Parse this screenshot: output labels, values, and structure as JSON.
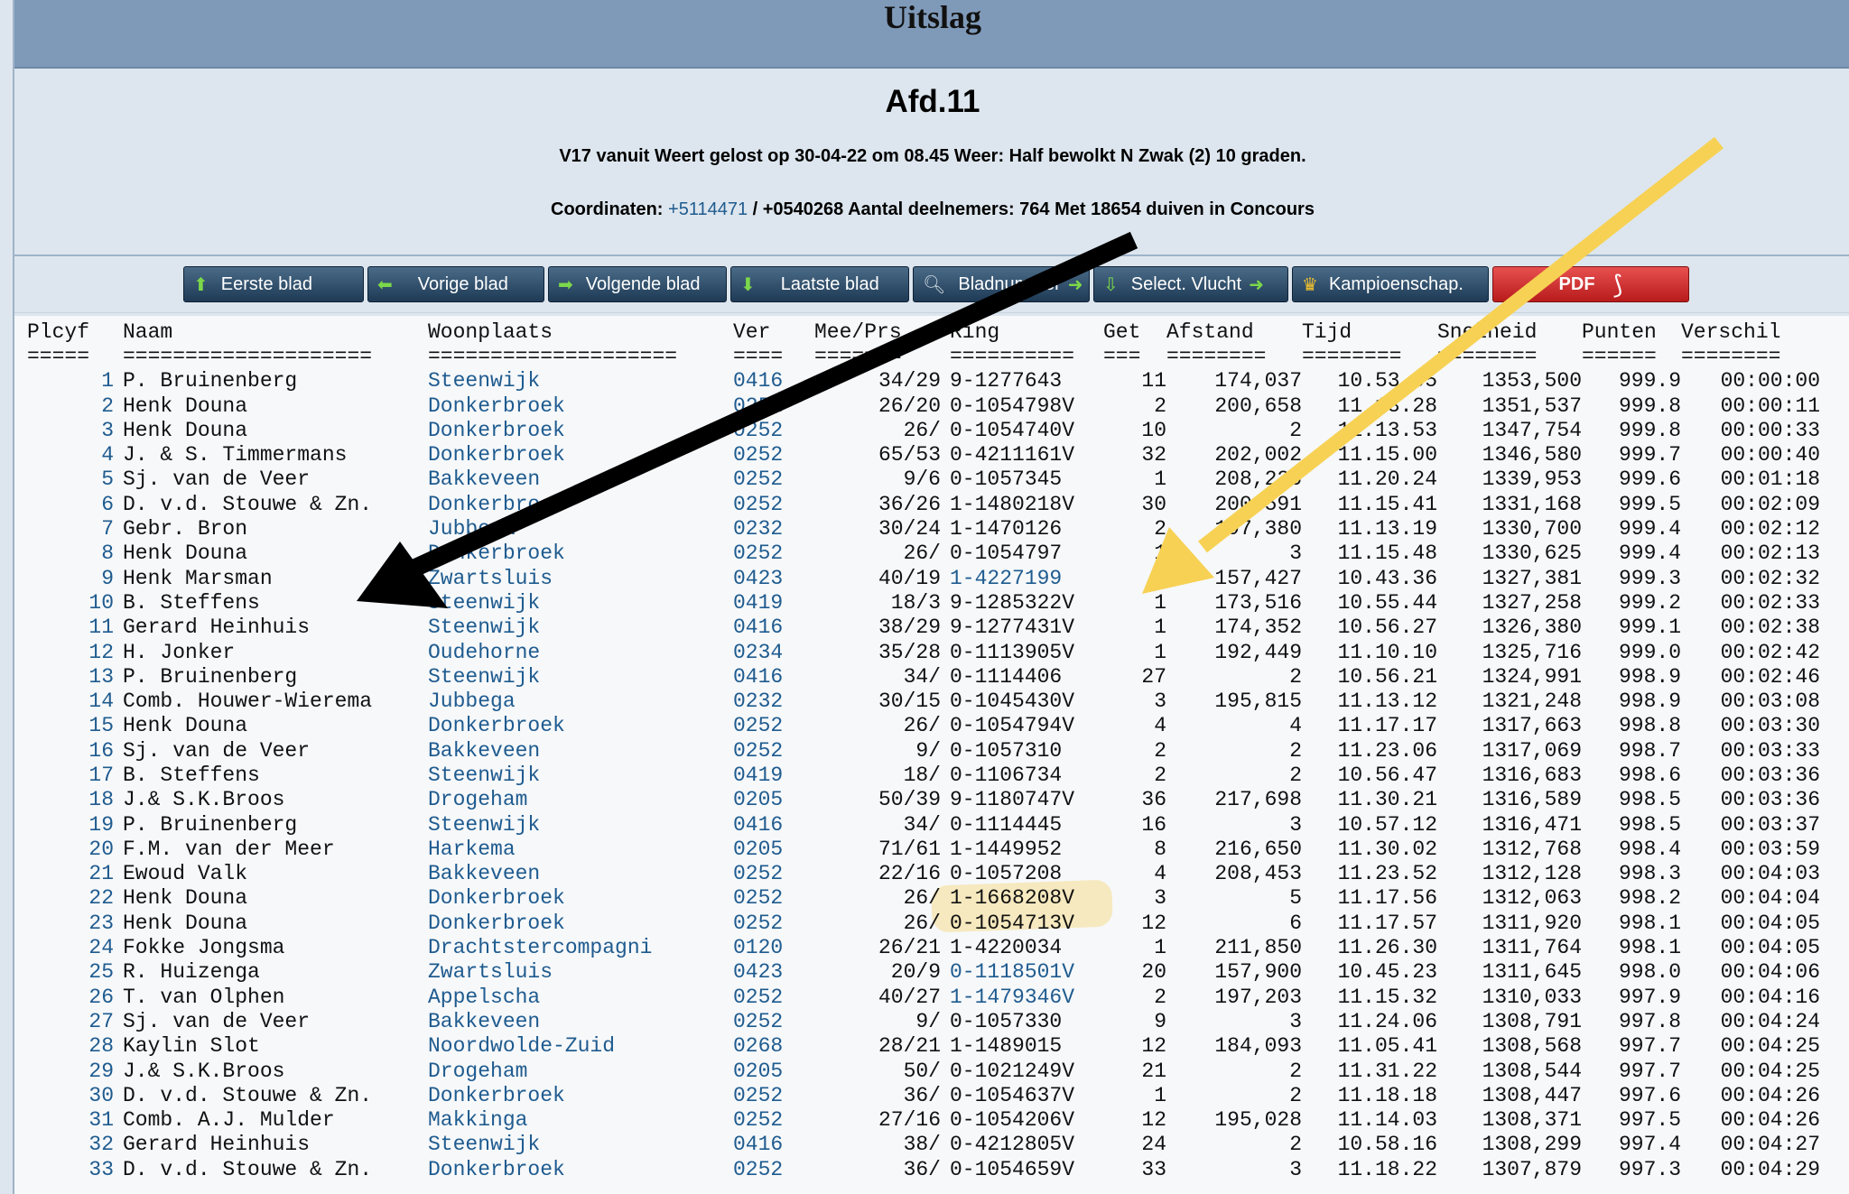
{
  "header": {
    "title": "Uitslag"
  },
  "info": {
    "afdeling": "Afd.11",
    "line1": "V17 vanuit Weert gelost op 30-04-22 om 08.45 Weer: Half bewolkt N Zwak (2) 10 graden.",
    "coord_label": "Coordinaten:",
    "coord_link": "+5114471",
    "coord_rest": "/ +0540268 Aantal deelnemers: 764 Met 18654 duiven in Concours"
  },
  "toolbar": {
    "first": "Eerste blad",
    "prev": "Vorige blad",
    "next": "Volgende blad",
    "last": "Laatste blad",
    "pagenum": "Bladnummer",
    "select": "Select. Vlucht",
    "kamp": "Kampioenschap.",
    "pdf": "PDF"
  },
  "table": {
    "headers": [
      "Plcyf",
      "Naam",
      "Woonplaats",
      "Ver",
      "Mee/Prs",
      "Ring",
      "Get",
      "Afstand",
      "Tijd",
      "Snelheid",
      "Punten",
      "Verschil"
    ],
    "separators": [
      "=====",
      "====================",
      "====================",
      "====",
      "=======",
      "==========",
      "===",
      "========",
      "========",
      "========",
      "======",
      "========"
    ],
    "rows": [
      [
        "1",
        "P. Bruinenberg",
        "Steenwijk",
        "0416",
        "34/29",
        "9-1277643",
        "11",
        "174,037",
        "10.53.05",
        "1353,500",
        "999.9",
        "00:00:00"
      ],
      [
        "2",
        "Henk Douna",
        "Donkerbroek",
        "0252",
        "26/20",
        "0-1054798V",
        "2",
        "200,658",
        "11.13.28",
        "1351,537",
        "999.8",
        "00:00:11"
      ],
      [
        "3",
        "Henk Douna",
        "Donkerbroek",
        "0252",
        "26/",
        "0-1054740V",
        "10",
        "2",
        "11.13.53",
        "1347,754",
        "999.8",
        "00:00:33"
      ],
      [
        "4",
        "J. & S. Timmermans",
        "Donkerbroek",
        "0252",
        "65/53",
        "0-4211161V",
        "32",
        "202,002",
        "11.15.00",
        "1346,580",
        "999.7",
        "00:00:40"
      ],
      [
        "5",
        "Sj. van de Veer",
        "Bakkeveen",
        "0252",
        "9/6",
        "0-1057345",
        "1",
        "208,226",
        "11.20.24",
        "1339,953",
        "999.6",
        "00:01:18"
      ],
      [
        "6",
        "D. v.d. Stouwe & Zn.",
        "Donkerbroek",
        "0252",
        "36/26",
        "1-1480218V",
        "30",
        "200,591",
        "11.15.41",
        "1331,168",
        "999.5",
        "00:02:09"
      ],
      [
        "7",
        "Gebr. Bron",
        "Jubbega",
        "0232",
        "30/24",
        "1-1470126",
        "2",
        "197,380",
        "11.13.19",
        "1330,700",
        "999.4",
        "00:02:12"
      ],
      [
        "8",
        "Henk Douna",
        "Donkerbroek",
        "0252",
        "26/",
        "0-1054797",
        "1",
        "3",
        "11.15.48",
        "1330,625",
        "999.4",
        "00:02:13"
      ],
      [
        "9",
        "Henk Marsman",
        "Zwartsluis",
        "0423",
        "40/19",
        "1-4227199",
        "1",
        "157,427",
        "10.43.36",
        "1327,381",
        "999.3",
        "00:02:32"
      ],
      [
        "10",
        "B. Steffens",
        "Steenwijk",
        "0419",
        "18/3",
        "9-1285322V",
        "1",
        "173,516",
        "10.55.44",
        "1327,258",
        "999.2",
        "00:02:33"
      ],
      [
        "11",
        "Gerard Heinhuis",
        "Steenwijk",
        "0416",
        "38/29",
        "9-1277431V",
        "1",
        "174,352",
        "10.56.27",
        "1326,380",
        "999.1",
        "00:02:38"
      ],
      [
        "12",
        "H. Jonker",
        "Oudehorne",
        "0234",
        "35/28",
        "0-1113905V",
        "1",
        "192,449",
        "11.10.10",
        "1325,716",
        "999.0",
        "00:02:42"
      ],
      [
        "13",
        "P. Bruinenberg",
        "Steenwijk",
        "0416",
        "34/",
        "0-1114406",
        "27",
        "2",
        "10.56.21",
        "1324,991",
        "998.9",
        "00:02:46"
      ],
      [
        "14",
        "Comb. Houwer-Wierema",
        "Jubbega",
        "0232",
        "30/15",
        "0-1045430V",
        "3",
        "195,815",
        "11.13.12",
        "1321,248",
        "998.9",
        "00:03:08"
      ],
      [
        "15",
        "Henk Douna",
        "Donkerbroek",
        "0252",
        "26/",
        "0-1054794V",
        "4",
        "4",
        "11.17.17",
        "1317,663",
        "998.8",
        "00:03:30"
      ],
      [
        "16",
        "Sj. van de Veer",
        "Bakkeveen",
        "0252",
        "9/",
        "0-1057310",
        "2",
        "2",
        "11.23.06",
        "1317,069",
        "998.7",
        "00:03:33"
      ],
      [
        "17",
        "B. Steffens",
        "Steenwijk",
        "0419",
        "18/",
        "0-1106734",
        "2",
        "2",
        "10.56.47",
        "1316,683",
        "998.6",
        "00:03:36"
      ],
      [
        "18",
        "J.& S.K.Broos",
        "Drogeham",
        "0205",
        "50/39",
        "9-1180747V",
        "36",
        "217,698",
        "11.30.21",
        "1316,589",
        "998.5",
        "00:03:36"
      ],
      [
        "19",
        "P. Bruinenberg",
        "Steenwijk",
        "0416",
        "34/",
        "0-1114445",
        "16",
        "3",
        "10.57.12",
        "1316,471",
        "998.5",
        "00:03:37"
      ],
      [
        "20",
        "F.M. van der Meer",
        "Harkema",
        "0205",
        "71/61",
        "1-1449952",
        "8",
        "216,650",
        "11.30.02",
        "1312,768",
        "998.4",
        "00:03:59"
      ],
      [
        "21",
        "Ewoud Valk",
        "Bakkeveen",
        "0252",
        "22/16",
        "0-1057208",
        "4",
        "208,453",
        "11.23.52",
        "1312,128",
        "998.3",
        "00:04:03"
      ],
      [
        "22",
        "Henk Douna",
        "Donkerbroek",
        "0252",
        "26/",
        "1-1668208V",
        "3",
        "5",
        "11.17.56",
        "1312,063",
        "998.2",
        "00:04:04"
      ],
      [
        "23",
        "Henk Douna",
        "Donkerbroek",
        "0252",
        "26/",
        "0-1054713V",
        "12",
        "6",
        "11.17.57",
        "1311,920",
        "998.1",
        "00:04:05"
      ],
      [
        "24",
        "Fokke Jongsma",
        "Drachtstercompagni",
        "0120",
        "26/21",
        "1-4220034",
        "1",
        "211,850",
        "11.26.30",
        "1311,764",
        "998.1",
        "00:04:05"
      ],
      [
        "25",
        "R. Huizenga",
        "Zwartsluis",
        "0423",
        "20/9",
        "0-1118501V",
        "20",
        "157,900",
        "10.45.23",
        "1311,645",
        "998.0",
        "00:04:06"
      ],
      [
        "26",
        "T. van Olphen",
        "Appelscha",
        "0252",
        "40/27",
        "1-1479346V",
        "2",
        "197,203",
        "11.15.32",
        "1310,033",
        "997.9",
        "00:04:16"
      ],
      [
        "27",
        "Sj. van de Veer",
        "Bakkeveen",
        "0252",
        "9/",
        "0-1057330",
        "9",
        "3",
        "11.24.06",
        "1308,791",
        "997.8",
        "00:04:24"
      ],
      [
        "28",
        "Kaylin Slot",
        "Noordwolde-Zuid",
        "0268",
        "28/21",
        "1-1489015",
        "12",
        "184,093",
        "11.05.41",
        "1308,568",
        "997.7",
        "00:04:25"
      ],
      [
        "29",
        "J.& S.K.Broos",
        "Drogeham",
        "0205",
        "50/",
        "0-1021249V",
        "21",
        "2",
        "11.31.22",
        "1308,544",
        "997.7",
        "00:04:25"
      ],
      [
        "30",
        "D. v.d. Stouwe & Zn.",
        "Donkerbroek",
        "0252",
        "36/",
        "0-1054637V",
        "1",
        "2",
        "11.18.18",
        "1308,447",
        "997.6",
        "00:04:26"
      ],
      [
        "31",
        "Comb. A.J. Mulder",
        "Makkinga",
        "0252",
        "27/16",
        "0-1054206V",
        "12",
        "195,028",
        "11.14.03",
        "1308,371",
        "997.5",
        "00:04:26"
      ],
      [
        "32",
        "Gerard Heinhuis",
        "Steenwijk",
        "0416",
        "38/",
        "0-4212805V",
        "24",
        "2",
        "10.58.16",
        "1308,299",
        "997.4",
        "00:04:27"
      ],
      [
        "33",
        "D. v.d. Stouwe & Zn.",
        "Donkerbroek",
        "0252",
        "36/",
        "0-1054659V",
        "33",
        "3",
        "11.18.22",
        "1307,879",
        "997.3",
        "00:04:29"
      ]
    ],
    "blue_ring_rows": [
      9,
      25,
      26
    ]
  },
  "colors": {
    "header_bg": "#7f9ab9",
    "link": "#1f5b8f",
    "arrow_black": "#000000",
    "arrow_yellow": "#f7d154"
  }
}
